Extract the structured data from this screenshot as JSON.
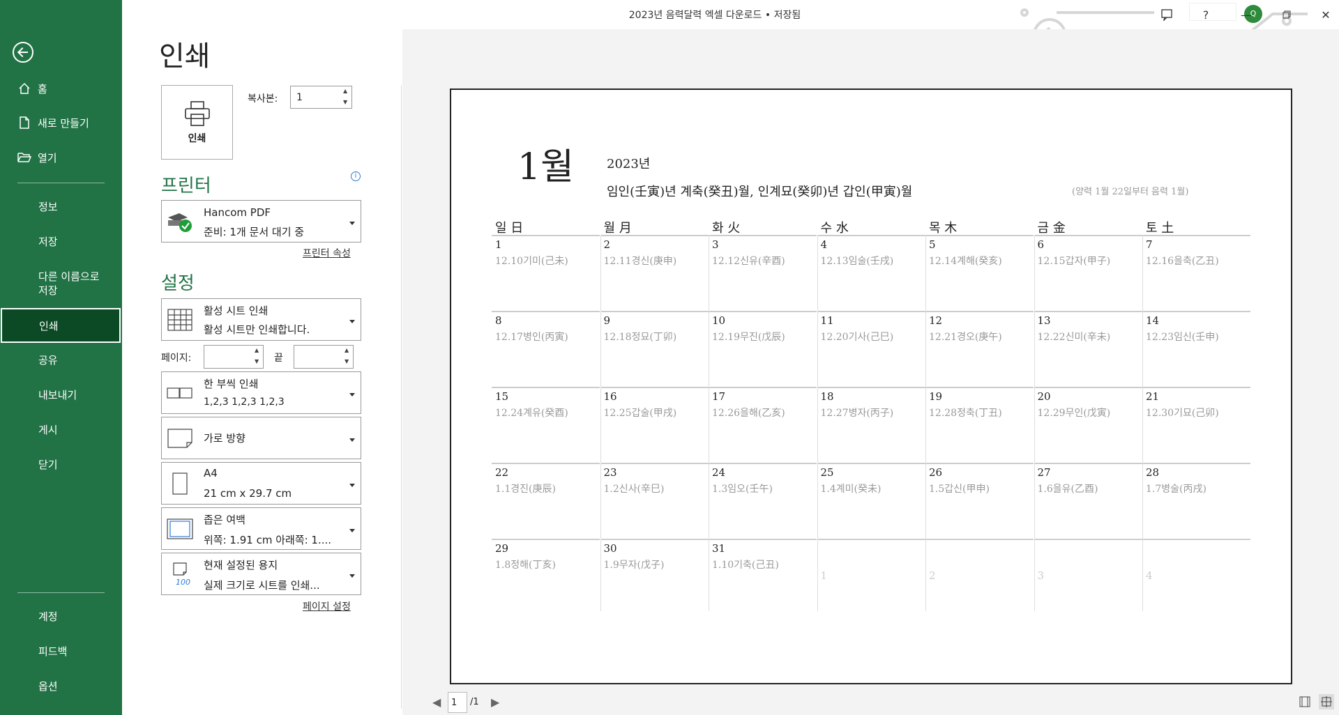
{
  "window": {
    "title": "2023년 음력달력 엑셀 다운로드 • 저장됨",
    "avatar_text": "Q"
  },
  "sidebar": {
    "items": [
      {
        "label": "홈",
        "icon": "home-icon"
      },
      {
        "label": "새로 만들기",
        "icon": "new-document-icon"
      },
      {
        "label": "열기",
        "icon": "folder-open-icon"
      },
      {
        "label": "정보"
      },
      {
        "label": "저장"
      },
      {
        "label": "다른 이름으로\n저장"
      },
      {
        "label": "인쇄",
        "active": true
      },
      {
        "label": "공유"
      },
      {
        "label": "내보내기"
      },
      {
        "label": "게시"
      },
      {
        "label": "닫기"
      },
      {
        "label": "계정"
      },
      {
        "label": "피드백"
      },
      {
        "label": "옵션"
      }
    ]
  },
  "print": {
    "page_title": "인쇄",
    "print_button": "인쇄",
    "copies_label": "복사본:",
    "copies_value": "1",
    "printer_heading": "프린터",
    "printer": {
      "name": "Hancom PDF",
      "status": "준비: 1개 문서 대기 중"
    },
    "printer_properties": "프린터 속성",
    "settings_heading": "설정",
    "what": {
      "l1": "활성 시트 인쇄",
      "l2": "활성 시트만 인쇄합니다."
    },
    "pages_label": "페이지:",
    "to_label": "끝",
    "collate": {
      "l1": "한 부씩 인쇄",
      "l2": "1,2,3     1,2,3     1,2,3"
    },
    "orientation": {
      "l1": "가로 방향"
    },
    "paper": {
      "l1": "A4",
      "l2": "21 cm x 29.7 cm"
    },
    "margins": {
      "l1": "좁은 여백",
      "l2": "위쪽: 1.91 cm 아래쪽: 1...."
    },
    "scaling": {
      "l1": "현재 설정된 용지",
      "l2": "실제 크기로 시트를 인쇄...",
      "badge": "100"
    },
    "page_setup": "페이지 설정"
  },
  "calendar": {
    "month": "1월",
    "year": "2023년",
    "ganzhi": "임인(壬寅)년 계축(癸丑)월, 인계묘(癸卯)년 갑인(甲寅)월",
    "note": "(양력 1월 22일부터 음력 1월)",
    "weekdays": [
      "일 日",
      "월 月",
      "화 火",
      "수 水",
      "목 木",
      "금 金",
      "토 土"
    ],
    "weeks": [
      [
        {
          "d": "1",
          "l": "12.10기미(己未)"
        },
        {
          "d": "2",
          "l": "12.11경신(庚申)"
        },
        {
          "d": "3",
          "l": "12.12신유(辛酉)"
        },
        {
          "d": "4",
          "l": "12.13임술(壬戌)"
        },
        {
          "d": "5",
          "l": "12.14계해(癸亥)"
        },
        {
          "d": "6",
          "l": "12.15갑자(甲子)"
        },
        {
          "d": "7",
          "l": "12.16을축(乙丑)"
        }
      ],
      [
        {
          "d": "8",
          "l": "12.17병인(丙寅)"
        },
        {
          "d": "9",
          "l": "12.18정묘(丁卯)"
        },
        {
          "d": "10",
          "l": "12.19무진(戊辰)"
        },
        {
          "d": "11",
          "l": "12.20기사(己巳)"
        },
        {
          "d": "12",
          "l": "12.21경오(庚午)"
        },
        {
          "d": "13",
          "l": "12.22신미(辛未)"
        },
        {
          "d": "14",
          "l": "12.23임신(壬申)"
        }
      ],
      [
        {
          "d": "15",
          "l": "12.24계유(癸酉)"
        },
        {
          "d": "16",
          "l": "12.25갑술(甲戌)"
        },
        {
          "d": "17",
          "l": "12.26을해(乙亥)"
        },
        {
          "d": "18",
          "l": "12.27병자(丙子)"
        },
        {
          "d": "19",
          "l": "12.28정축(丁丑)"
        },
        {
          "d": "20",
          "l": "12.29무인(戊寅)"
        },
        {
          "d": "21",
          "l": "12.30기묘(己卯)"
        }
      ],
      [
        {
          "d": "22",
          "l": "1.1경진(庚辰)"
        },
        {
          "d": "23",
          "l": "1.2신사(辛巳)"
        },
        {
          "d": "24",
          "l": "1.3임오(壬午)"
        },
        {
          "d": "25",
          "l": "1.4계미(癸未)"
        },
        {
          "d": "26",
          "l": "1.5갑신(甲申)"
        },
        {
          "d": "27",
          "l": "1.6을유(乙酉)"
        },
        {
          "d": "28",
          "l": "1.7병술(丙戌)"
        }
      ],
      [
        {
          "d": "29",
          "l": "1.8정해(丁亥)"
        },
        {
          "d": "30",
          "l": "1.9무자(戊子)"
        },
        {
          "d": "31",
          "l": "1.10기축(己丑)"
        },
        {
          "d": "1",
          "next": true
        },
        {
          "d": "2",
          "next": true
        },
        {
          "d": "3",
          "next": true
        },
        {
          "d": "4",
          "next": true
        }
      ]
    ]
  },
  "pager": {
    "current": "1",
    "total": "/1"
  }
}
